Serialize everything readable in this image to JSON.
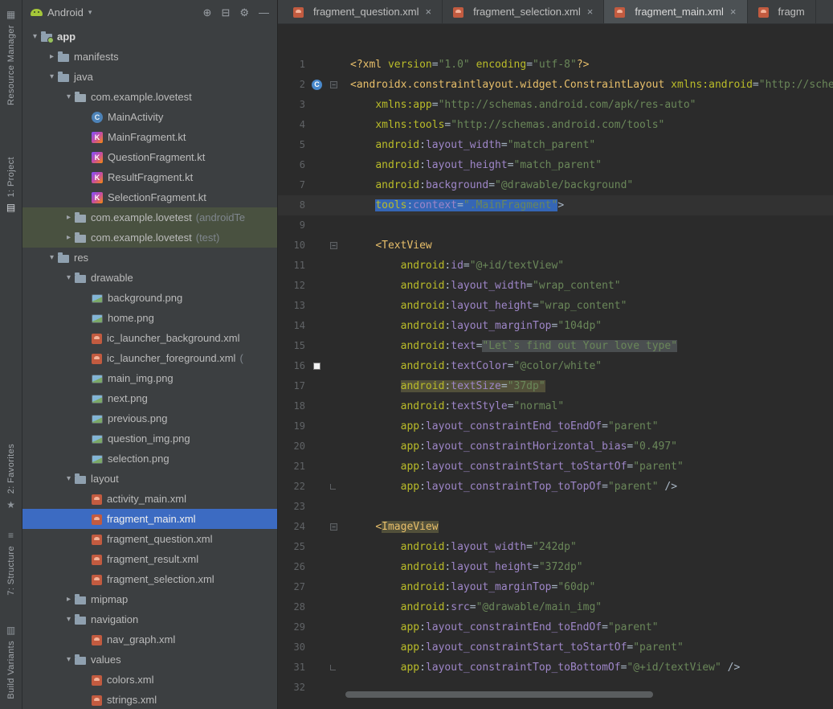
{
  "colors": {
    "panel_bg": "#3C3F41",
    "editor_bg": "#2B2B2B",
    "selection_blue": "#3C6BC2",
    "text_selection_blue": "#3566B5",
    "warning_highlight": "#52503A",
    "android_green": "#A4C639",
    "string_green": "#6A8759",
    "tag_yellow": "#E8BF6A",
    "attr_olive": "#BABC29"
  },
  "stripe": {
    "icon_glyphs": {
      "resource-manager": "▦",
      "project": "▤",
      "favorites-star": "★",
      "structure": "≡",
      "build-variants": "▥"
    },
    "items": [
      {
        "id": "resource-manager",
        "label": "Resource Manager",
        "icon": "resource-manager",
        "group": "top"
      },
      {
        "id": "project",
        "label": "1: Project",
        "icon": "project",
        "group": "top",
        "active": true,
        "icon_pos": "after"
      },
      {
        "id": "favorites",
        "label": "2: Favorites",
        "icon": "favorites-star",
        "group": "bottom",
        "icon_pos": "after"
      },
      {
        "id": "structure",
        "label": "7: Structure",
        "icon": "structure",
        "group": "bottom"
      },
      {
        "id": "build-variants",
        "label": "Build Variants",
        "icon": "build-variants",
        "group": "bottom"
      }
    ]
  },
  "project_panel": {
    "selector": {
      "label": "Android",
      "dd_arrow": "▾"
    },
    "header_icons": [
      {
        "name": "locate",
        "glyph": "⊕"
      },
      {
        "name": "collapse-all",
        "glyph": "⊟"
      },
      {
        "name": "settings",
        "glyph": "⚙"
      },
      {
        "name": "hide-panel",
        "glyph": "—"
      }
    ],
    "file_icon_glyphs": {
      "class": "C",
      "kotlin": "K"
    },
    "tree": [
      {
        "level": 0,
        "chevron": "down",
        "icon": "app-folder",
        "label": "app",
        "bold": true
      },
      {
        "level": 1,
        "chevron": "right",
        "icon": "folder",
        "label": "manifests"
      },
      {
        "level": 1,
        "chevron": "down",
        "icon": "folder",
        "label": "java"
      },
      {
        "level": 2,
        "chevron": "down",
        "icon": "package",
        "label": "com.example.lovetest"
      },
      {
        "level": 3,
        "chevron": null,
        "icon": "class",
        "label": "MainActivity"
      },
      {
        "level": 3,
        "chevron": null,
        "icon": "kotlin",
        "label": "MainFragment.kt"
      },
      {
        "level": 3,
        "chevron": null,
        "icon": "kotlin",
        "label": "QuestionFragment.kt"
      },
      {
        "level": 3,
        "chevron": null,
        "icon": "kotlin",
        "label": "ResultFragment.kt"
      },
      {
        "level": 3,
        "chevron": null,
        "icon": "kotlin",
        "label": "SelectionFragment.kt"
      },
      {
        "level": 2,
        "chevron": "right",
        "icon": "package",
        "label": "com.example.lovetest",
        "suffix": "(androidTe",
        "tinted": true
      },
      {
        "level": 2,
        "chevron": "right",
        "icon": "package",
        "label": "com.example.lovetest",
        "suffix": "(test)",
        "tinted": true
      },
      {
        "level": 1,
        "chevron": "down",
        "icon": "folder",
        "label": "res"
      },
      {
        "level": 2,
        "chevron": "down",
        "icon": "folder",
        "label": "drawable"
      },
      {
        "level": 3,
        "chevron": null,
        "icon": "image",
        "label": "background.png"
      },
      {
        "level": 3,
        "chevron": null,
        "icon": "image",
        "label": "home.png"
      },
      {
        "level": 3,
        "chevron": null,
        "icon": "android-xml",
        "label": "ic_launcher_background.xml"
      },
      {
        "level": 3,
        "chevron": null,
        "icon": "android-xml",
        "label": "ic_launcher_foreground.xml",
        "suffix": "("
      },
      {
        "level": 3,
        "chevron": null,
        "icon": "image",
        "label": "main_img.png"
      },
      {
        "level": 3,
        "chevron": null,
        "icon": "image",
        "label": "next.png"
      },
      {
        "level": 3,
        "chevron": null,
        "icon": "image",
        "label": "previous.png"
      },
      {
        "level": 3,
        "chevron": null,
        "icon": "image",
        "label": "question_img.png"
      },
      {
        "level": 3,
        "chevron": null,
        "icon": "image",
        "label": "selection.png"
      },
      {
        "level": 2,
        "chevron": "down",
        "icon": "folder",
        "label": "layout"
      },
      {
        "level": 3,
        "chevron": null,
        "icon": "android-xml",
        "label": "activity_main.xml"
      },
      {
        "level": 3,
        "chevron": null,
        "icon": "android-xml",
        "label": "fragment_main.xml",
        "selected": true
      },
      {
        "level": 3,
        "chevron": null,
        "icon": "android-xml",
        "label": "fragment_question.xml"
      },
      {
        "level": 3,
        "chevron": null,
        "icon": "android-xml",
        "label": "fragment_result.xml"
      },
      {
        "level": 3,
        "chevron": null,
        "icon": "android-xml",
        "label": "fragment_selection.xml"
      },
      {
        "level": 2,
        "chevron": "right",
        "icon": "folder",
        "label": "mipmap"
      },
      {
        "level": 2,
        "chevron": "down",
        "icon": "folder",
        "label": "navigation"
      },
      {
        "level": 3,
        "chevron": null,
        "icon": "android-xml",
        "label": "nav_graph.xml"
      },
      {
        "level": 2,
        "chevron": "down",
        "icon": "folder",
        "label": "values"
      },
      {
        "level": 3,
        "chevron": null,
        "icon": "android-xml",
        "label": "colors.xml"
      },
      {
        "level": 3,
        "chevron": null,
        "icon": "android-xml",
        "label": "strings.xml"
      }
    ]
  },
  "tabs": [
    {
      "label": "fragment_question.xml",
      "close": "×"
    },
    {
      "label": "fragment_selection.xml",
      "close": "×"
    },
    {
      "label": "fragment_main.xml",
      "close": "×",
      "active": true
    },
    {
      "label": "fragm",
      "cut": true
    }
  ],
  "editor": {
    "lines": [
      {
        "num": 1,
        "tokens": [
          [
            "t",
            "<?xml "
          ],
          [
            "p",
            "version"
          ],
          [
            "d",
            "="
          ],
          [
            "s",
            "\"1.0\""
          ],
          [
            "d",
            " "
          ],
          [
            "p",
            "encoding"
          ],
          [
            "d",
            "="
          ],
          [
            "s",
            "\"utf-8\""
          ],
          [
            "t",
            "?>"
          ]
        ]
      },
      {
        "num": 2,
        "gutter_icon": "class",
        "fold": "start",
        "tokens": [
          [
            "t",
            "<androidx.constraintlayout.widget.ConstraintLayout"
          ],
          [
            "d",
            " "
          ],
          [
            "p",
            "xmlns:android"
          ],
          [
            "d",
            "="
          ],
          [
            "s",
            "\"http://schemas.android.com/apk/res/android\""
          ]
        ]
      },
      {
        "num": 3,
        "tokens": [
          [
            "d",
            "    "
          ],
          [
            "p",
            "xmlns:app"
          ],
          [
            "d",
            "="
          ],
          [
            "s",
            "\"http://schemas.android.com/apk/res-auto\""
          ]
        ]
      },
      {
        "num": 4,
        "tokens": [
          [
            "d",
            "    "
          ],
          [
            "p",
            "xmlns:tools"
          ],
          [
            "d",
            "="
          ],
          [
            "s",
            "\"http://schemas.android.com/tools\""
          ]
        ]
      },
      {
        "num": 5,
        "tokens": [
          [
            "d",
            "    "
          ],
          [
            "p",
            "android"
          ],
          [
            "d",
            ":"
          ],
          [
            "n",
            "layout_width"
          ],
          [
            "d",
            "="
          ],
          [
            "s",
            "\"match_parent\""
          ]
        ]
      },
      {
        "num": 6,
        "tokens": [
          [
            "d",
            "    "
          ],
          [
            "p",
            "android"
          ],
          [
            "d",
            ":"
          ],
          [
            "n",
            "layout_height"
          ],
          [
            "d",
            "="
          ],
          [
            "s",
            "\"match_parent\""
          ]
        ]
      },
      {
        "num": 7,
        "tokens": [
          [
            "d",
            "    "
          ],
          [
            "p",
            "android"
          ],
          [
            "d",
            ":"
          ],
          [
            "n",
            "background"
          ],
          [
            "d",
            "="
          ],
          [
            "s",
            "\"@drawable/background\""
          ]
        ]
      },
      {
        "num": 8,
        "caret": true,
        "tokens": [
          [
            "d",
            "    "
          ],
          [
            "p",
            "tools",
            "sel"
          ],
          [
            "d",
            ":",
            "sel"
          ],
          [
            "n",
            "context",
            "sel"
          ],
          [
            "d",
            "=",
            "sel"
          ],
          [
            "s",
            "\".MainFragment\"",
            "sel"
          ],
          [
            "d",
            ">"
          ]
        ]
      },
      {
        "num": 9,
        "tokens": []
      },
      {
        "num": 10,
        "fold": "start",
        "tokens": [
          [
            "d",
            "    "
          ],
          [
            "t",
            "<TextView"
          ]
        ]
      },
      {
        "num": 11,
        "tokens": [
          [
            "d",
            "        "
          ],
          [
            "p",
            "android"
          ],
          [
            "d",
            ":"
          ],
          [
            "n",
            "id"
          ],
          [
            "d",
            "="
          ],
          [
            "s",
            "\"@+id/textView\""
          ]
        ]
      },
      {
        "num": 12,
        "tokens": [
          [
            "d",
            "        "
          ],
          [
            "p",
            "android"
          ],
          [
            "d",
            ":"
          ],
          [
            "n",
            "layout_width"
          ],
          [
            "d",
            "="
          ],
          [
            "s",
            "\"wrap_content\""
          ]
        ]
      },
      {
        "num": 13,
        "tokens": [
          [
            "d",
            "        "
          ],
          [
            "p",
            "android"
          ],
          [
            "d",
            ":"
          ],
          [
            "n",
            "layout_height"
          ],
          [
            "d",
            "="
          ],
          [
            "s",
            "\"wrap_content\""
          ]
        ]
      },
      {
        "num": 14,
        "tokens": [
          [
            "d",
            "        "
          ],
          [
            "p",
            "android"
          ],
          [
            "d",
            ":"
          ],
          [
            "n",
            "layout_marginTop"
          ],
          [
            "d",
            "="
          ],
          [
            "s",
            "\"104dp\""
          ]
        ]
      },
      {
        "num": 15,
        "tokens": [
          [
            "d",
            "        "
          ],
          [
            "p",
            "android"
          ],
          [
            "d",
            ":"
          ],
          [
            "n",
            "text"
          ],
          [
            "d",
            "="
          ],
          [
            "s",
            "\"Let`s find out Your love type\"",
            "gray"
          ]
        ]
      },
      {
        "num": 16,
        "gutter_icon": "swatch",
        "tokens": [
          [
            "d",
            "        "
          ],
          [
            "p",
            "android"
          ],
          [
            "d",
            ":"
          ],
          [
            "n",
            "textColor"
          ],
          [
            "d",
            "="
          ],
          [
            "s",
            "\"@color/white\""
          ]
        ]
      },
      {
        "num": 17,
        "tokens": [
          [
            "d",
            "        "
          ],
          [
            "p",
            "android",
            "warn"
          ],
          [
            "d",
            ":",
            "warn"
          ],
          [
            "n",
            "textSize",
            "warn"
          ],
          [
            "d",
            "=",
            "warn"
          ],
          [
            "s",
            "\"37dp\"",
            "warn"
          ]
        ]
      },
      {
        "num": 18,
        "tokens": [
          [
            "d",
            "        "
          ],
          [
            "p",
            "android"
          ],
          [
            "d",
            ":"
          ],
          [
            "n",
            "textStyle"
          ],
          [
            "d",
            "="
          ],
          [
            "s",
            "\"normal\""
          ]
        ]
      },
      {
        "num": 19,
        "tokens": [
          [
            "d",
            "        "
          ],
          [
            "p",
            "app"
          ],
          [
            "d",
            ":"
          ],
          [
            "n",
            "layout_constraintEnd_toEndOf"
          ],
          [
            "d",
            "="
          ],
          [
            "s",
            "\"parent\""
          ]
        ]
      },
      {
        "num": 20,
        "tokens": [
          [
            "d",
            "        "
          ],
          [
            "p",
            "app"
          ],
          [
            "d",
            ":"
          ],
          [
            "n",
            "layout_constraintHorizontal_bias"
          ],
          [
            "d",
            "="
          ],
          [
            "s",
            "\"0.497\""
          ]
        ]
      },
      {
        "num": 21,
        "tokens": [
          [
            "d",
            "        "
          ],
          [
            "p",
            "app"
          ],
          [
            "d",
            ":"
          ],
          [
            "n",
            "layout_constraintStart_toStartOf"
          ],
          [
            "d",
            "="
          ],
          [
            "s",
            "\"parent\""
          ]
        ]
      },
      {
        "num": 22,
        "fold": "end",
        "tokens": [
          [
            "d",
            "        "
          ],
          [
            "p",
            "app"
          ],
          [
            "d",
            ":"
          ],
          [
            "n",
            "layout_constraintTop_toTopOf"
          ],
          [
            "d",
            "="
          ],
          [
            "s",
            "\"parent\""
          ],
          [
            "d",
            " />"
          ]
        ]
      },
      {
        "num": 23,
        "tokens": []
      },
      {
        "num": 24,
        "fold": "start",
        "tokens": [
          [
            "d",
            "    "
          ],
          [
            "t",
            "<"
          ],
          [
            "t",
            "ImageView",
            "warn"
          ]
        ]
      },
      {
        "num": 25,
        "tokens": [
          [
            "d",
            "        "
          ],
          [
            "p",
            "android"
          ],
          [
            "d",
            ":"
          ],
          [
            "n",
            "layout_width"
          ],
          [
            "d",
            "="
          ],
          [
            "s",
            "\"242dp\""
          ]
        ]
      },
      {
        "num": 26,
        "tokens": [
          [
            "d",
            "        "
          ],
          [
            "p",
            "android"
          ],
          [
            "d",
            ":"
          ],
          [
            "n",
            "layout_height"
          ],
          [
            "d",
            "="
          ],
          [
            "s",
            "\"372dp\""
          ]
        ]
      },
      {
        "num": 27,
        "tokens": [
          [
            "d",
            "        "
          ],
          [
            "p",
            "android"
          ],
          [
            "d",
            ":"
          ],
          [
            "n",
            "layout_marginTop"
          ],
          [
            "d",
            "="
          ],
          [
            "s",
            "\"60dp\""
          ]
        ]
      },
      {
        "num": 28,
        "tokens": [
          [
            "d",
            "        "
          ],
          [
            "p",
            "android"
          ],
          [
            "d",
            ":"
          ],
          [
            "n",
            "src"
          ],
          [
            "d",
            "="
          ],
          [
            "s",
            "\"@drawable/main_img\""
          ]
        ]
      },
      {
        "num": 29,
        "tokens": [
          [
            "d",
            "        "
          ],
          [
            "p",
            "app"
          ],
          [
            "d",
            ":"
          ],
          [
            "n",
            "layout_constraintEnd_toEndOf"
          ],
          [
            "d",
            "="
          ],
          [
            "s",
            "\"parent\""
          ]
        ]
      },
      {
        "num": 30,
        "tokens": [
          [
            "d",
            "        "
          ],
          [
            "p",
            "app"
          ],
          [
            "d",
            ":"
          ],
          [
            "n",
            "layout_constraintStart_toStartOf"
          ],
          [
            "d",
            "="
          ],
          [
            "s",
            "\"parent\""
          ]
        ]
      },
      {
        "num": 31,
        "fold": "end",
        "tokens": [
          [
            "d",
            "        "
          ],
          [
            "p",
            "app"
          ],
          [
            "d",
            ":"
          ],
          [
            "n",
            "layout_constraintTop_toBottomOf"
          ],
          [
            "d",
            "="
          ],
          [
            "s",
            "\"@+id/textView\""
          ],
          [
            "d",
            " />"
          ]
        ]
      },
      {
        "num": 32,
        "tokens": []
      }
    ]
  }
}
